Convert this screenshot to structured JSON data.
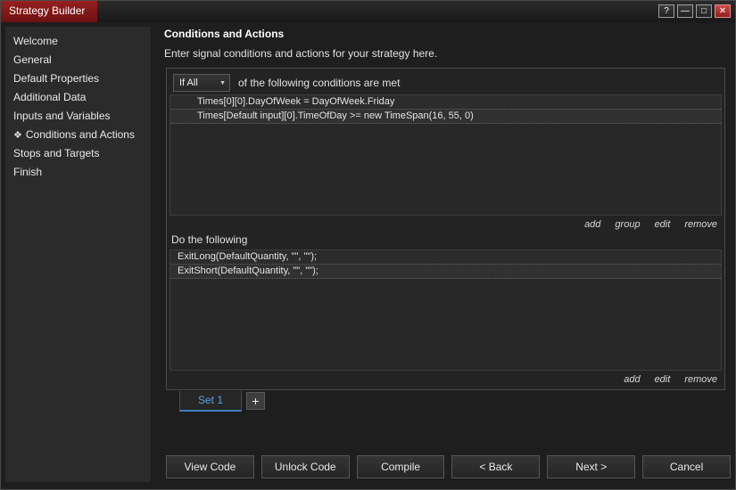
{
  "window": {
    "title": "Strategy Builder",
    "controls": {
      "help": "?",
      "minimize": "—",
      "maximize": "□",
      "close": "✕"
    }
  },
  "icons": {
    "dropdown_chevron": "▼"
  },
  "sidebar": {
    "items": [
      {
        "label": "Welcome"
      },
      {
        "label": "General"
      },
      {
        "label": "Default Properties"
      },
      {
        "label": "Additional Data"
      },
      {
        "label": "Inputs and Variables"
      },
      {
        "label": "Conditions and Actions",
        "icon": "❖",
        "selected": true
      },
      {
        "label": "Stops and Targets"
      },
      {
        "label": "Finish"
      }
    ]
  },
  "main": {
    "heading": "Conditions and Actions",
    "subtitle": "Enter signal conditions and actions for your strategy here.",
    "conditions": {
      "dropdown_value": "If All",
      "dropdown_suffix": "of the following conditions are met",
      "rows": [
        "Times[0][0].DayOfWeek = DayOfWeek.Friday",
        "Times[Default input][0].TimeOfDay >= new TimeSpan(16, 55, 0)"
      ],
      "links": [
        "add",
        "group",
        "edit",
        "remove"
      ]
    },
    "actions": {
      "label": "Do the following",
      "rows": [
        "ExitLong(DefaultQuantity, \"\", \"\");",
        "ExitShort(DefaultQuantity, \"\", \"\");"
      ],
      "links": [
        "add",
        "edit",
        "remove"
      ]
    },
    "tabs": [
      {
        "label": "Set 1",
        "selected": true
      },
      {
        "label": "+"
      }
    ],
    "buttons": [
      "View Code",
      "Unlock Code",
      "Compile",
      "< Back",
      "Next >",
      "Cancel"
    ]
  }
}
